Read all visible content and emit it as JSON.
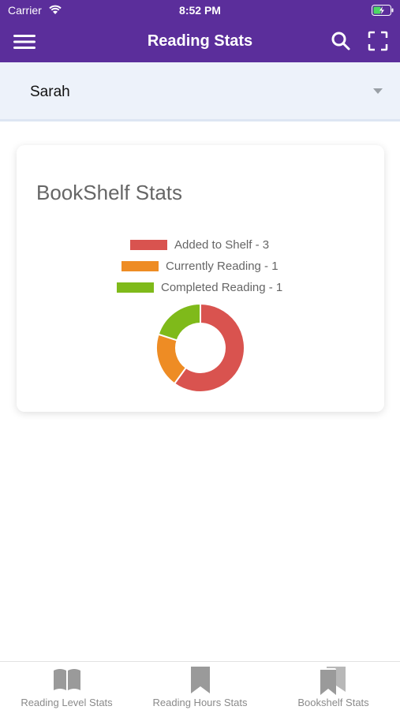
{
  "status_bar": {
    "carrier": "Carrier",
    "time": "8:52 PM"
  },
  "header": {
    "title": "Reading Stats"
  },
  "student_selector": {
    "value": "Sarah"
  },
  "card": {
    "title": "BookShelf Stats",
    "legend": [
      {
        "label": "Added to Shelf - 3",
        "color": "#d9534f"
      },
      {
        "label": "Currently Reading - 1",
        "color": "#ee8c24"
      },
      {
        "label": "Completed Reading - 1",
        "color": "#7fba1a"
      }
    ]
  },
  "chart_data": {
    "type": "pie",
    "categories": [
      "Added to Shelf",
      "Currently Reading",
      "Completed Reading"
    ],
    "values": [
      3,
      1,
      1
    ],
    "colors": [
      "#d9534f",
      "#ee8c24",
      "#7fba1a"
    ],
    "title": "BookShelf Stats",
    "legend_position": "top"
  },
  "tabs": [
    {
      "label": "Reading Level Stats",
      "icon": "open-book-icon"
    },
    {
      "label": "Reading Hours Stats",
      "icon": "bookmark-icon"
    },
    {
      "label": "Bookshelf Stats",
      "icon": "stacked-bookmarks-icon"
    }
  ]
}
